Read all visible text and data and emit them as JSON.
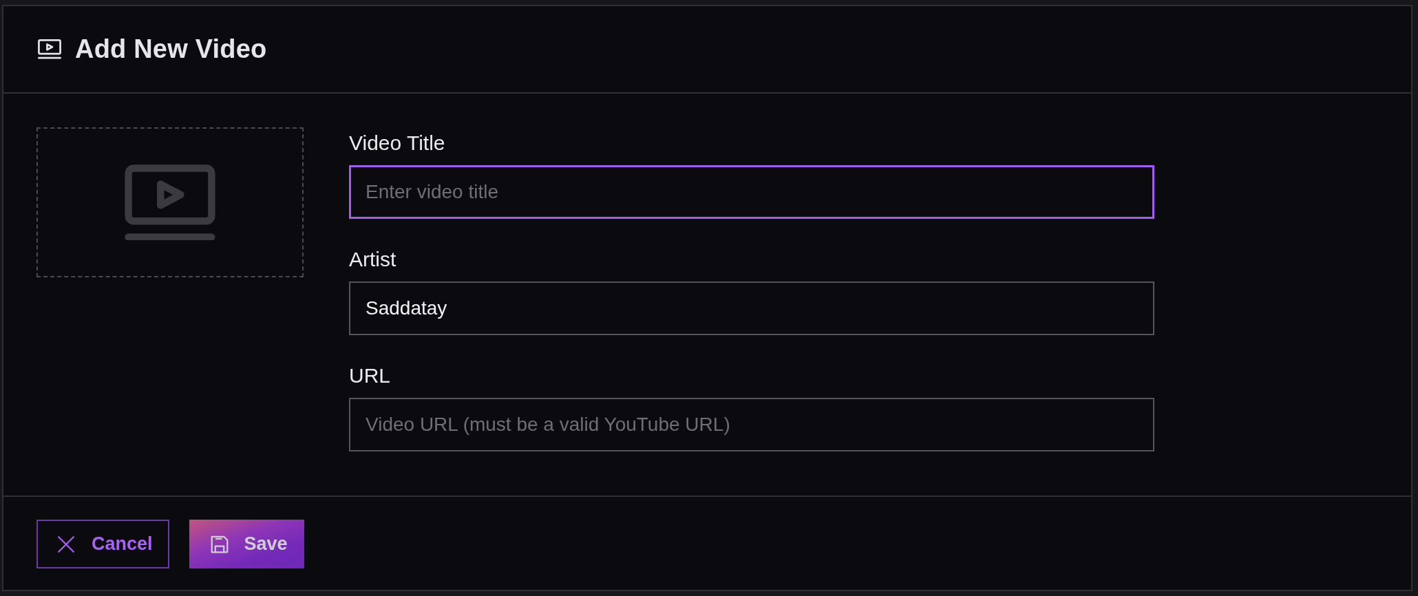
{
  "dialog": {
    "title": "Add New Video"
  },
  "fields": [
    {
      "label": "Video Title",
      "placeholder": "Enter video title",
      "focused": true
    },
    {
      "label": "Artist",
      "value": "Saddatay",
      "focused": false
    },
    {
      "label": "URL",
      "placeholder": "Video URL (must be a valid YouTube URL)",
      "focused": false
    }
  ],
  "buttons": [
    {
      "kind": "cancel",
      "label": "Cancel"
    },
    {
      "kind": "save",
      "label": "Save"
    }
  ]
}
